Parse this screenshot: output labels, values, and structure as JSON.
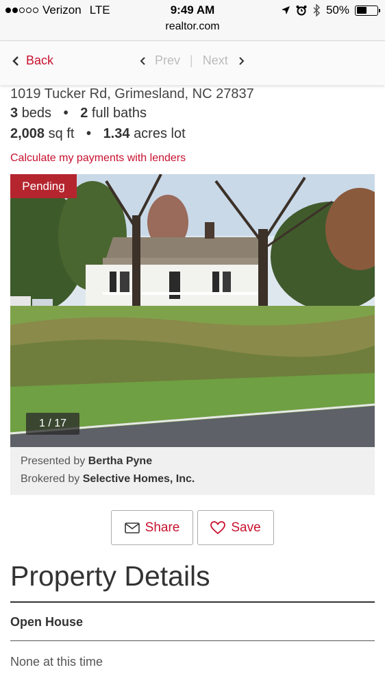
{
  "status_bar": {
    "carrier": "Verizon",
    "network": "LTE",
    "time": "9:49 AM",
    "battery_text": "50%",
    "battery_level": 0.5,
    "signal_bars_filled": 2,
    "signal_bars_total": 5
  },
  "url_bar": {
    "domain": "realtor.com"
  },
  "nav": {
    "back_label": "Back",
    "prev_label": "Prev",
    "separator": "|",
    "next_label": "Next"
  },
  "listing": {
    "address": "1019 Tucker Rd, Grimesland, NC 27837",
    "beds_value": "3",
    "beds_unit": "beds",
    "baths_value": "2",
    "baths_unit": "full baths",
    "sqft_value": "2,008",
    "sqft_unit": "sq ft",
    "lot_value": "1.34",
    "lot_unit": "acres lot",
    "bullet": "•",
    "calc_link": "Calculate my payments with lenders",
    "status_badge": "Pending",
    "photo_counter": "1 / 17",
    "presented_prefix": "Presented by",
    "agent_name": "Bertha Pyne",
    "brokered_prefix": "Brokered by",
    "broker_name": "Selective Homes, Inc."
  },
  "actions": {
    "share_label": "Share",
    "save_label": "Save"
  },
  "details": {
    "title": "Property Details",
    "open_house_label": "Open House",
    "open_house_value": "None at this time"
  },
  "colors": {
    "accent": "#c8102e",
    "badge": "#b5252e"
  }
}
